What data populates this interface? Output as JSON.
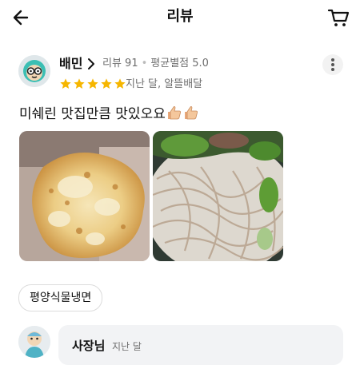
{
  "header": {
    "title": "리뷰",
    "back_icon": "arrow-left-icon",
    "cart_icon": "cart-icon"
  },
  "review": {
    "reviewer_name": "배민",
    "review_count": "리뷰 91",
    "average_rating": "평균별점 5.0",
    "rating": 5,
    "max_rating": 5,
    "star_color": "#f6b600",
    "date_and_order": "지난 달, 알뜰배달",
    "text": "미쉐린 맛집만큼 맛있오요",
    "emoji": "thumbs-up-icon",
    "photos": [
      "pancake-photo",
      "noodle-photo"
    ],
    "menu_tag": "평양식물냉면"
  },
  "owner_reply": {
    "name": "사장님",
    "date": "지난 달"
  }
}
